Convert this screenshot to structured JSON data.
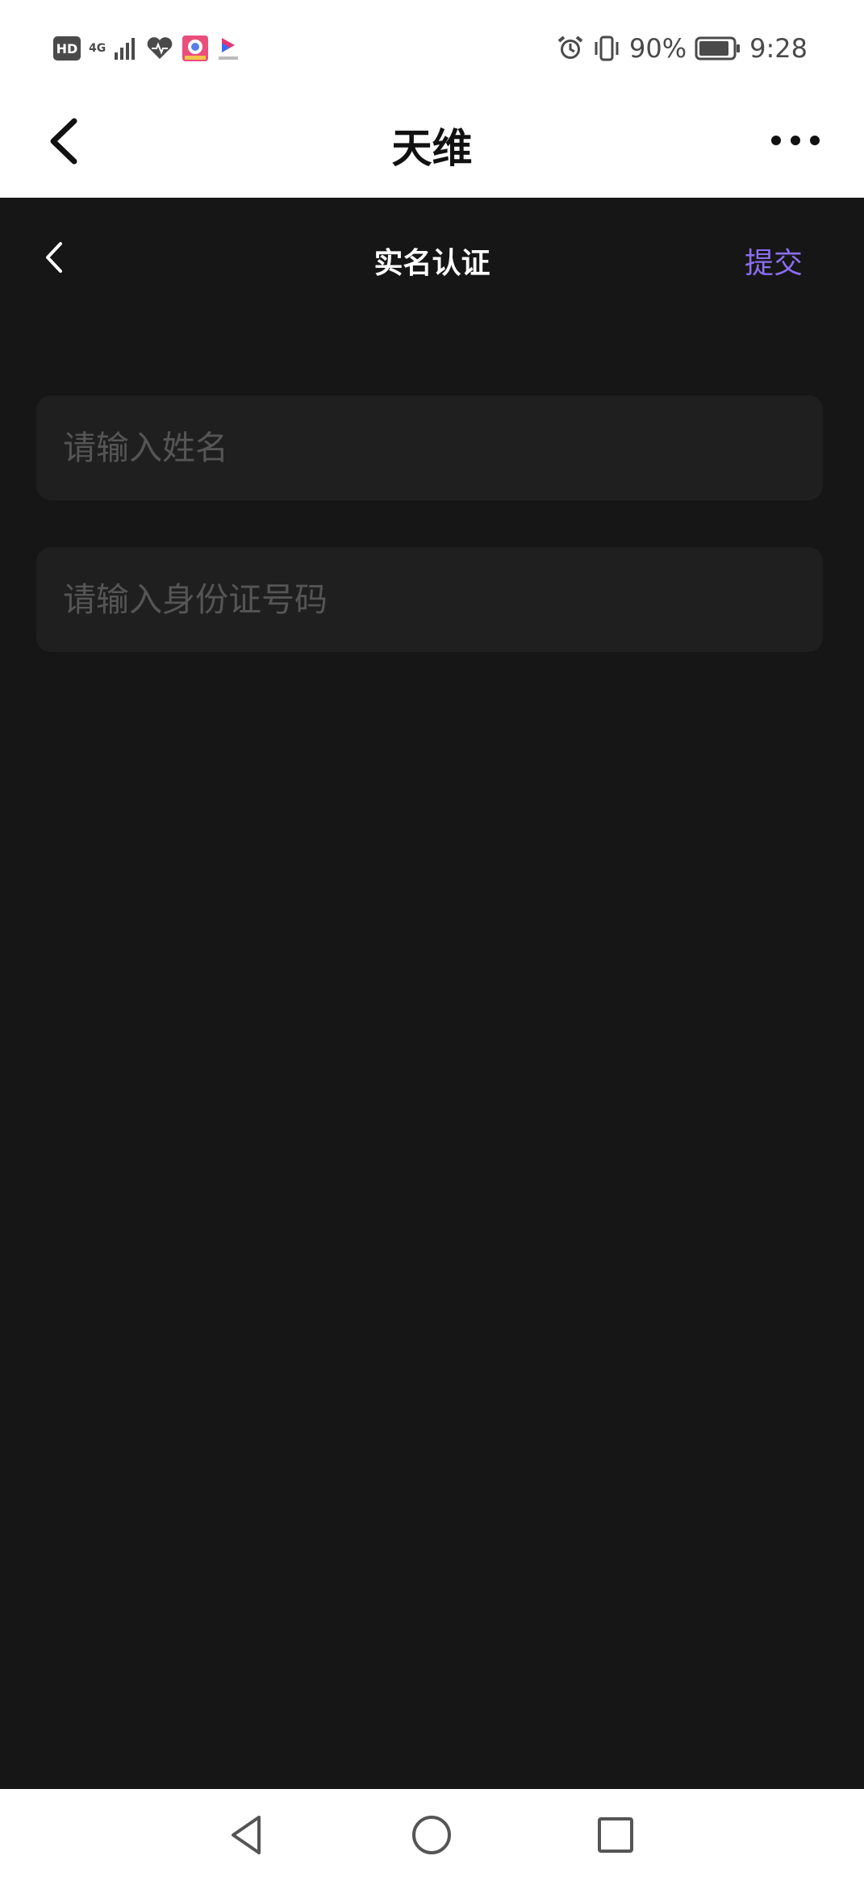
{
  "status_bar": {
    "network_type": "4G",
    "battery_percent": "90%",
    "battery_level": 0.9,
    "time": "9:28",
    "icons": [
      "hd-icon",
      "signal-icon",
      "heart-icon",
      "app-notification-icon",
      "app-notification-icon-2",
      "alarm-icon",
      "vibrate-icon",
      "battery-icon"
    ]
  },
  "app_header": {
    "title": "天维"
  },
  "page": {
    "title": "实名认证",
    "submit_label": "提交",
    "accent_color": "#8a6ef0"
  },
  "form": {
    "name_placeholder": "请输入姓名",
    "id_placeholder": "请输入身份证号码"
  }
}
